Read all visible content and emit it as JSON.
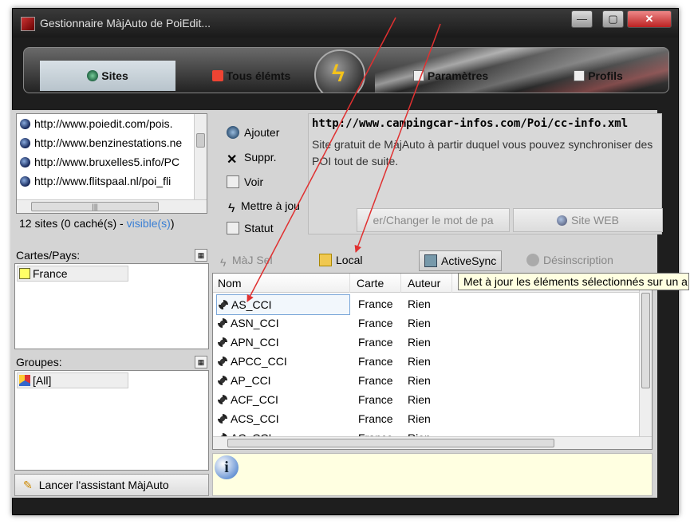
{
  "window": {
    "title": "Gestionnaire MàjAuto de PoiEdit..."
  },
  "window_controls": {
    "minimize": "—",
    "maximize": "▢",
    "close": "✕"
  },
  "tabs": [
    {
      "label": "Sites",
      "active": true
    },
    {
      "label": "Tous élémts",
      "active": false
    },
    {
      "label": "Paramètres",
      "active": false
    },
    {
      "label": "Profils",
      "active": false
    }
  ],
  "sites": {
    "items": [
      "http://www.poiedit.com/pois.",
      "http://www.benzinestations.ne",
      "http://www.bruxelles5.info/PC",
      "http://www.flitspaal.nl/poi_fli"
    ],
    "count_text": "12 sites (0 caché(s) - ",
    "visible_link": "visible(s)",
    "count_close": ")"
  },
  "site_actions": {
    "add": "Ajouter",
    "delete": "Suppr.",
    "view": "Voir",
    "update": "Mettre à jou",
    "status": "Statut"
  },
  "site_info": {
    "url": "http://www.campingcar-infos.com/Poi/cc-info.xml",
    "description": "Site gratuit de MàjAuto à partir duquel vous pouvez synchroniser des POI tout de suite.",
    "password_button": "er/Changer le mot de  pa",
    "web_button": "Site WEB"
  },
  "cartes": {
    "label": "Cartes/Pays:",
    "items": [
      "France"
    ]
  },
  "groupes": {
    "label": "Groupes:",
    "items": [
      "[All]"
    ]
  },
  "assistant_button": "Lancer l'assistant MàjAuto",
  "toolbar": {
    "maj": "MàJ Sel",
    "local": "Local",
    "activesync": "ActiveSync",
    "desinscription": "Désinscription"
  },
  "tooltip": "Met à jour les éléments sélectionnés sur un a",
  "table": {
    "columns": [
      "Nom",
      "Carte",
      "Auteur"
    ],
    "rows": [
      {
        "nom": "AS_CCI",
        "carte": "France",
        "auteur": "Rien"
      },
      {
        "nom": "ASN_CCI",
        "carte": "France",
        "auteur": "Rien"
      },
      {
        "nom": "APN_CCI",
        "carte": "France",
        "auteur": "Rien"
      },
      {
        "nom": "APCC_CCI",
        "carte": "France",
        "auteur": "Rien"
      },
      {
        "nom": "AP_CCI",
        "carte": "France",
        "auteur": "Rien"
      },
      {
        "nom": "ACF_CCI",
        "carte": "France",
        "auteur": "Rien"
      },
      {
        "nom": "ACS_CCI",
        "carte": "France",
        "auteur": "Rien"
      },
      {
        "nom": "AC_CCI",
        "carte": "France",
        "auteur": "Rien"
      }
    ]
  },
  "info_bar": {
    "icon": "i"
  },
  "colors": {
    "annotation_arrow": "#e03030",
    "tooltip_bg": "#ffffe1",
    "link": "#3a7fd4"
  }
}
